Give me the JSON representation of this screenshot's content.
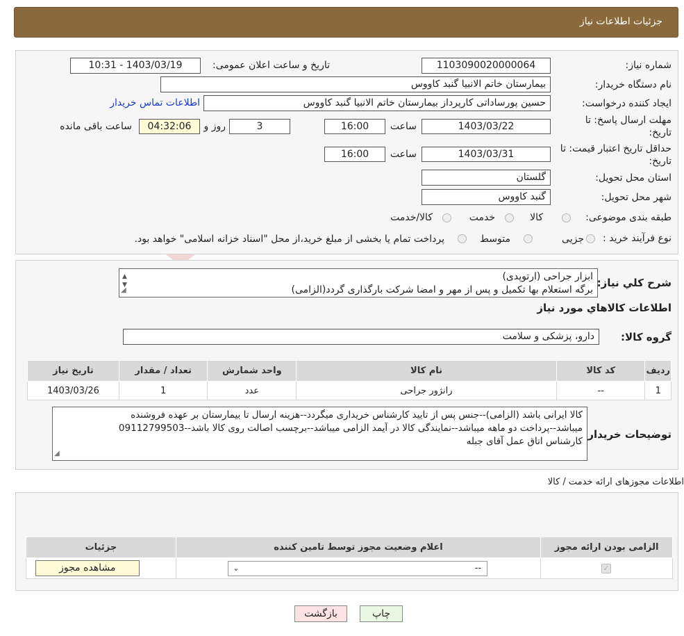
{
  "header": {
    "title": "جزئیات اطلاعات نیاز"
  },
  "need": {
    "number_label": "شماره نیاز:",
    "number": "1103090020000064",
    "announce_label": "تاریخ و ساعت اعلان عمومی:",
    "announce_value": "1403/03/19 - 10:31",
    "buyer_org_label": "نام دستگاه خریدار:",
    "buyer_org": "بیمارستان خاتم الانبیا گنبد کاووس",
    "requester_label": "ایجاد کننده درخواست:",
    "requester": "حسین پورساداتی کارپرداز بیمارستان خاتم الانبیا گنبد کاووس",
    "contact_link": "اطلاعات تماس خریدار",
    "deadline_label_1": "مهلت ارسال پاسخ: تا",
    "deadline_label_2": "تاریخ:",
    "deadline_date": "1403/03/22",
    "time_label": "ساعت",
    "deadline_time": "16:00",
    "days_value": "3",
    "days_label": "روز و",
    "remaining_time": "04:32:06",
    "remaining_label": "ساعت باقی مانده",
    "validity_label_1": "حداقل تاریخ اعتبار قیمت: تا",
    "validity_label_2": "تاریخ:",
    "validity_date": "1403/03/31",
    "validity_time": "16:00",
    "province_label": "استان محل تحویل:",
    "province": "گلستان",
    "city_label": "شهر محل تحویل:",
    "city": "گنبد کاووس",
    "category_label": "طبقه بندی موضوعی:",
    "category_options": [
      "کالا",
      "خدمت",
      "کالا/خدمت"
    ],
    "process_label": "نوع فرآیند خرید :",
    "process_options": [
      "جزیی",
      "متوسط"
    ],
    "process_note": "پرداخت تمام یا بخشی از مبلغ خرید،از محل \"اسناد خزانه اسلامی\" خواهد بود."
  },
  "summary": {
    "label": "شرح کلي نياز:",
    "line1": "ابزار جراحی (ارتوپدی)",
    "line2": "برگه استعلام بها تکمیل و پس از مهر و امضا شرکت بارگذاری گردد(الزامی)"
  },
  "goods": {
    "title": "اطلاعات کالاهاي مورد نياز",
    "group_label": "گروه کالا:",
    "group_value": "دارو، پزشکی و سلامت",
    "headers": [
      "رديف",
      "کد کالا",
      "نام کالا",
      "واحد شمارش",
      "تعداد / مقدار",
      "تاریخ نیاز"
    ],
    "rows": [
      [
        "1",
        "--",
        "رانژور جراحی",
        "عدد",
        "1",
        "1403/03/26"
      ]
    ]
  },
  "buyer_notes": {
    "label": "توضیحات خریدار:",
    "line1": "کالا ایرانی باشد (الزامی)--جنس پس از تایید کارشناس خریداری میگردد--هزینه ارسال تا بیمارستان بر عهده فروشنده",
    "line2": "میباشد--پرداخت دو ماهه میباشد--نمایندگی کالا در آیمد الزامی میباشد--برچسب اصالت روی کالا باشد--09112799503",
    "line3": "کارشناس اتاق عمل آقای جبله"
  },
  "permits": {
    "title": "اطلاعات مجوزهای ارائه خدمت / کالا",
    "headers": [
      "الزامی بودن ارائه مجوز",
      "اعلام وضعیت مجوز توسط تامین کننده",
      "جزئیات"
    ],
    "select_value": "--",
    "view_button": "مشاهده مجوز"
  },
  "actions": {
    "print": "چاپ",
    "back": "بازگشت"
  },
  "colors": {
    "header": "#8a6a3c",
    "link": "#1a39c6",
    "back_button": "#fde3e3",
    "print_button": "#eaf7e3"
  }
}
